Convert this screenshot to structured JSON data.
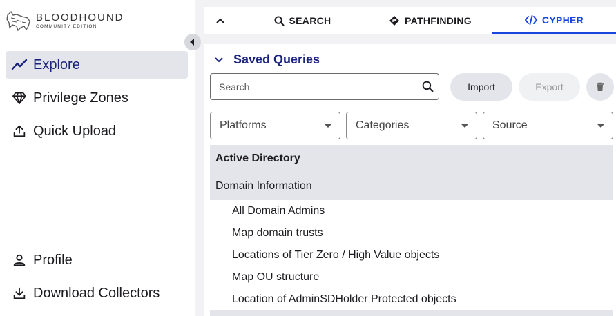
{
  "sidebar": {
    "logo": {
      "title": "BLOODHOUND",
      "subtitle": "COMMUNITY EDITION"
    },
    "nav_top": [
      {
        "label": "Explore",
        "icon": "trending-line-icon",
        "active": true
      },
      {
        "label": "Privilege Zones",
        "icon": "gem-icon",
        "active": false
      },
      {
        "label": "Quick Upload",
        "icon": "upload-icon",
        "active": false
      }
    ],
    "nav_bottom": [
      {
        "label": "Profile",
        "icon": "person-icon"
      },
      {
        "label": "Download Collectors",
        "icon": "download-icon"
      }
    ]
  },
  "tabs": [
    {
      "label": "SEARCH",
      "icon": "search-icon",
      "active": false
    },
    {
      "label": "PATHFINDING",
      "icon": "directions-icon",
      "active": false
    },
    {
      "label": "CYPHER",
      "icon": "code-icon",
      "active": true
    }
  ],
  "saved_queries": {
    "title": "Saved Queries",
    "search_placeholder": "Search",
    "import_label": "Import",
    "export_label": "Export",
    "filters": [
      "Platforms",
      "Categories",
      "Source"
    ],
    "groups": [
      {
        "label": "Active Directory"
      },
      {
        "label": "Domain Information"
      }
    ],
    "queries": [
      "All Domain Admins",
      "Map domain trusts",
      "Locations of Tier Zero / High Value objects",
      "Map OU structure",
      "Location of AdminSDHolder Protected objects"
    ]
  },
  "colors": {
    "accent": "#1a46e0",
    "nav_active": "#1a237e",
    "row_bg": "#e3e5ea"
  }
}
